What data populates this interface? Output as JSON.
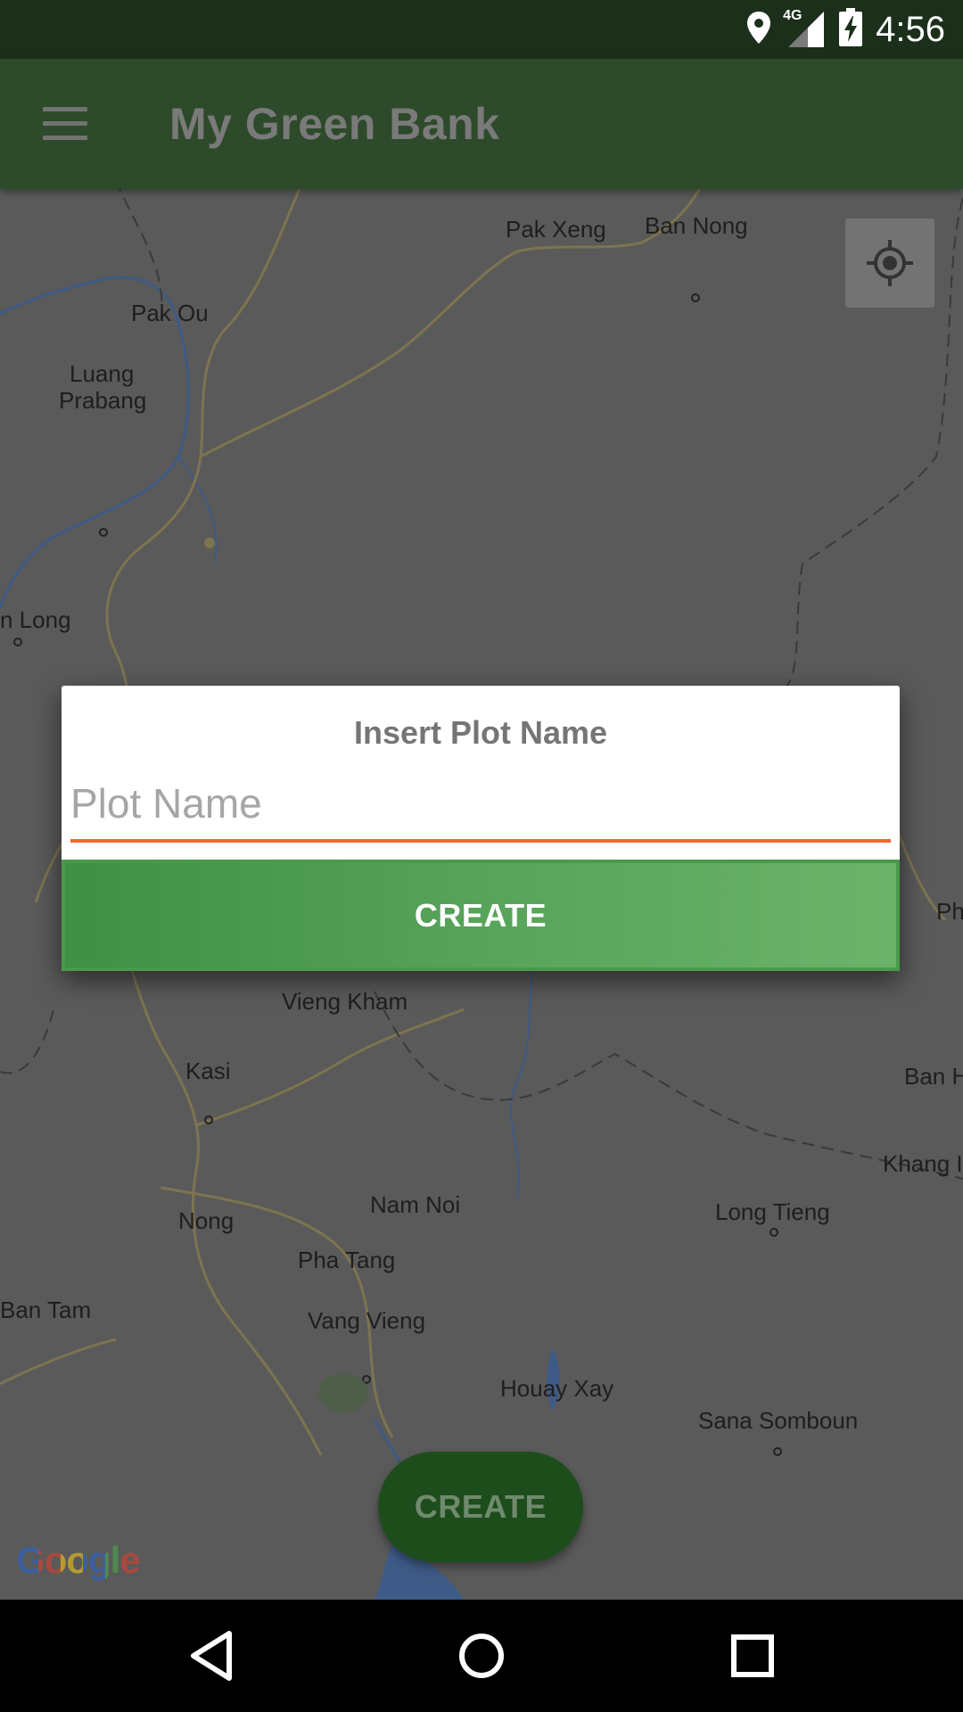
{
  "status_bar": {
    "time": "4:56",
    "network": "4G",
    "icons": [
      "location-icon",
      "signal-icon",
      "battery-charging-icon"
    ]
  },
  "app_bar": {
    "title": "My Green Bank",
    "menu_icon": "hamburger-menu-icon"
  },
  "map": {
    "labels": [
      "Pak Xeng",
      "Ban Nong",
      "Pak Ou",
      "Luang",
      "Prabang",
      "n Long",
      "Ph",
      "Vieng Kham",
      "Kasi",
      "Ban H",
      "Khang I",
      "Nam Noi",
      "Nong",
      "Long Tieng",
      "Pha Tang",
      "Ban Tam",
      "Vang Vieng",
      "Houay Xay",
      "Sana Somboun"
    ],
    "attribution": "Google",
    "my_location_icon": "my-location-icon"
  },
  "dialog": {
    "title": "Insert Plot Name",
    "input_placeholder": "Plot Name",
    "input_value": "",
    "button_label": "CREATE",
    "accent_color": "#f2682f",
    "button_color": "#5aa55c"
  },
  "bottom_action": {
    "label": "CREATE"
  },
  "nav_bar": {
    "icons": [
      "back-icon",
      "home-icon",
      "recents-icon"
    ]
  }
}
